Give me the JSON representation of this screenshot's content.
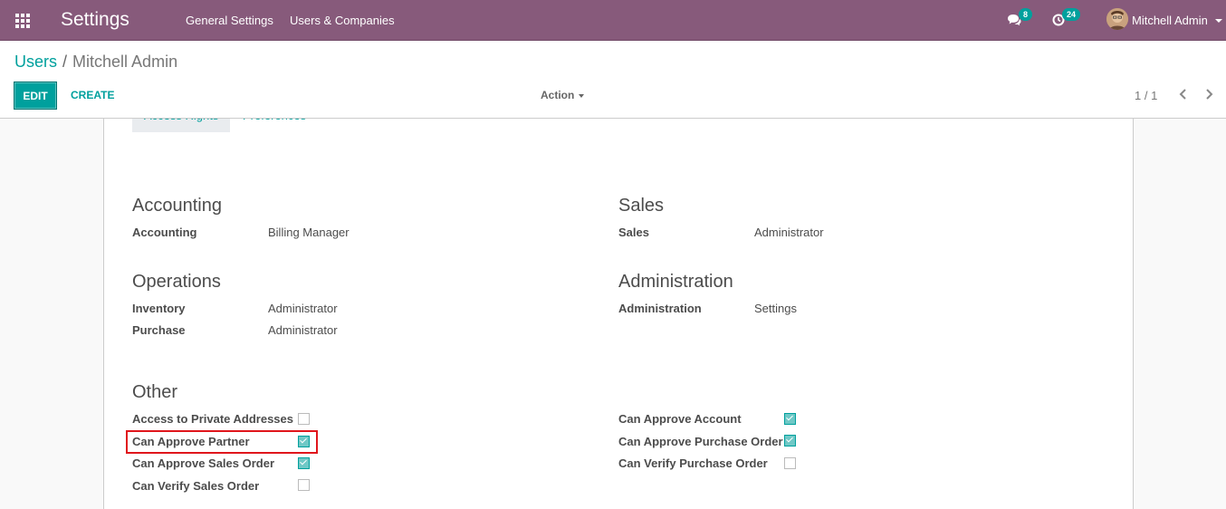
{
  "navbar": {
    "brand": "Settings",
    "menu": [
      "General Settings",
      "Users & Companies"
    ],
    "messages_count": "8",
    "activities_count": "24",
    "user_name": "Mitchell Admin"
  },
  "breadcrumb": {
    "parent": "Users",
    "separator": "/",
    "current": "Mitchell Admin"
  },
  "toolbar": {
    "edit_label": "EDIT",
    "create_label": "CREATE",
    "action_label": "Action",
    "pager": "1 / 1"
  },
  "tabs": [
    {
      "label": "Access Rights",
      "active": true
    },
    {
      "label": "Preferences",
      "active": false
    }
  ],
  "groups": {
    "accounting": {
      "title": "Accounting",
      "fields": [
        {
          "label": "Accounting",
          "value": "Billing Manager"
        }
      ]
    },
    "sales": {
      "title": "Sales",
      "fields": [
        {
          "label": "Sales",
          "value": "Administrator"
        }
      ]
    },
    "operations": {
      "title": "Operations",
      "fields": [
        {
          "label": "Inventory",
          "value": "Administrator"
        },
        {
          "label": "Purchase",
          "value": "Administrator"
        }
      ]
    },
    "administration": {
      "title": "Administration",
      "fields": [
        {
          "label": "Administration",
          "value": "Settings"
        }
      ]
    },
    "other": {
      "title": "Other",
      "left": [
        {
          "label": "Access to Private Addresses",
          "checked": false
        },
        {
          "label": "Can Approve Partner",
          "checked": true
        },
        {
          "label": "Can Approve Sales Order",
          "checked": true
        },
        {
          "label": "Can Verify Sales Order",
          "checked": false
        }
      ],
      "right": [
        {
          "label": "Can Approve Account",
          "checked": true
        },
        {
          "label": "Can Approve Purchase Order",
          "checked": true
        },
        {
          "label": "Can Verify Purchase Order",
          "checked": false
        }
      ]
    }
  },
  "colors": {
    "brand": "#875a7b",
    "accent": "#00a09d",
    "highlight": "#e0161c"
  }
}
